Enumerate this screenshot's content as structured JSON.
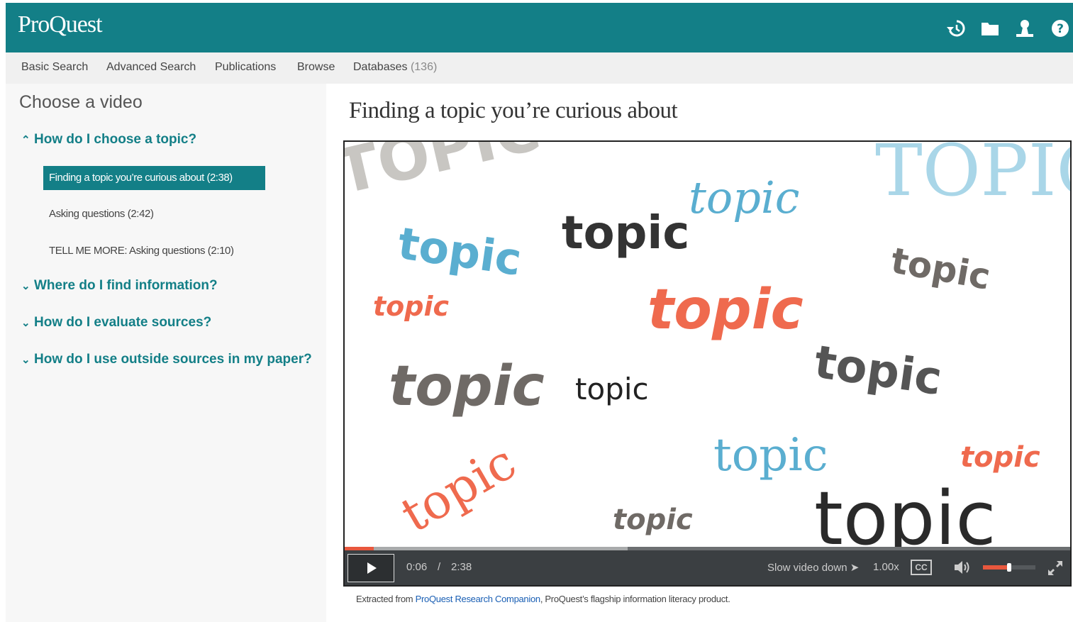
{
  "header": {
    "logo": "ProQuest",
    "icons": [
      "history-icon",
      "folder-icon",
      "user-icon",
      "help-icon"
    ]
  },
  "nav": {
    "items": [
      "Basic Search",
      "Advanced Search",
      "Publications",
      "Browse",
      "Databases"
    ],
    "databases_count": "(136)"
  },
  "sidebar": {
    "title": "Choose a video",
    "sections": [
      {
        "label": "How do I choose a topic?",
        "expanded": true,
        "videos": [
          {
            "label": "Finding a topic you’re curious about (2:38)",
            "active": true
          },
          {
            "label": "Asking questions (2:42)",
            "active": false
          },
          {
            "label": "TELL ME MORE: Asking questions (2:10)",
            "active": false
          }
        ]
      },
      {
        "label": "Where do I find information?",
        "expanded": false
      },
      {
        "label": "How do I evaluate sources?",
        "expanded": false
      },
      {
        "label": "How do I use outside sources in my paper?",
        "expanded": false
      }
    ]
  },
  "main": {
    "title": "Finding a topic you’re curious about"
  },
  "video": {
    "words": [
      "TOPIC",
      "topic",
      "topic",
      "topic",
      "topic",
      "TOPIC",
      "topic",
      "topic",
      "topic",
      "topic",
      "topic",
      "topic",
      "topic",
      "topic",
      "topic",
      "topic"
    ],
    "controls": {
      "current_time": "0:06",
      "separator": "/",
      "duration": "2:38",
      "speed_label": "Slow video down ➤",
      "speed_value": "1.00x",
      "cc_label": "CC",
      "progress_played": 0.04,
      "progress_buffered": 0.39,
      "volume_level": 0.5
    }
  },
  "caption": {
    "prefix": "Extracted from",
    "link": "ProQuest Research Companion",
    "suffix": ", ProQuest’s flagship information literacy product."
  },
  "colors": {
    "teal": "#137f87",
    "word_gray_light": "#c8c6c2",
    "word_blue": "#5aaed0",
    "word_blue_light": "#a9d6e8",
    "word_dark": "#333333",
    "word_gray": "#6f6a66",
    "word_orange": "#ef6a4e",
    "progress_red": "#e8573d"
  }
}
